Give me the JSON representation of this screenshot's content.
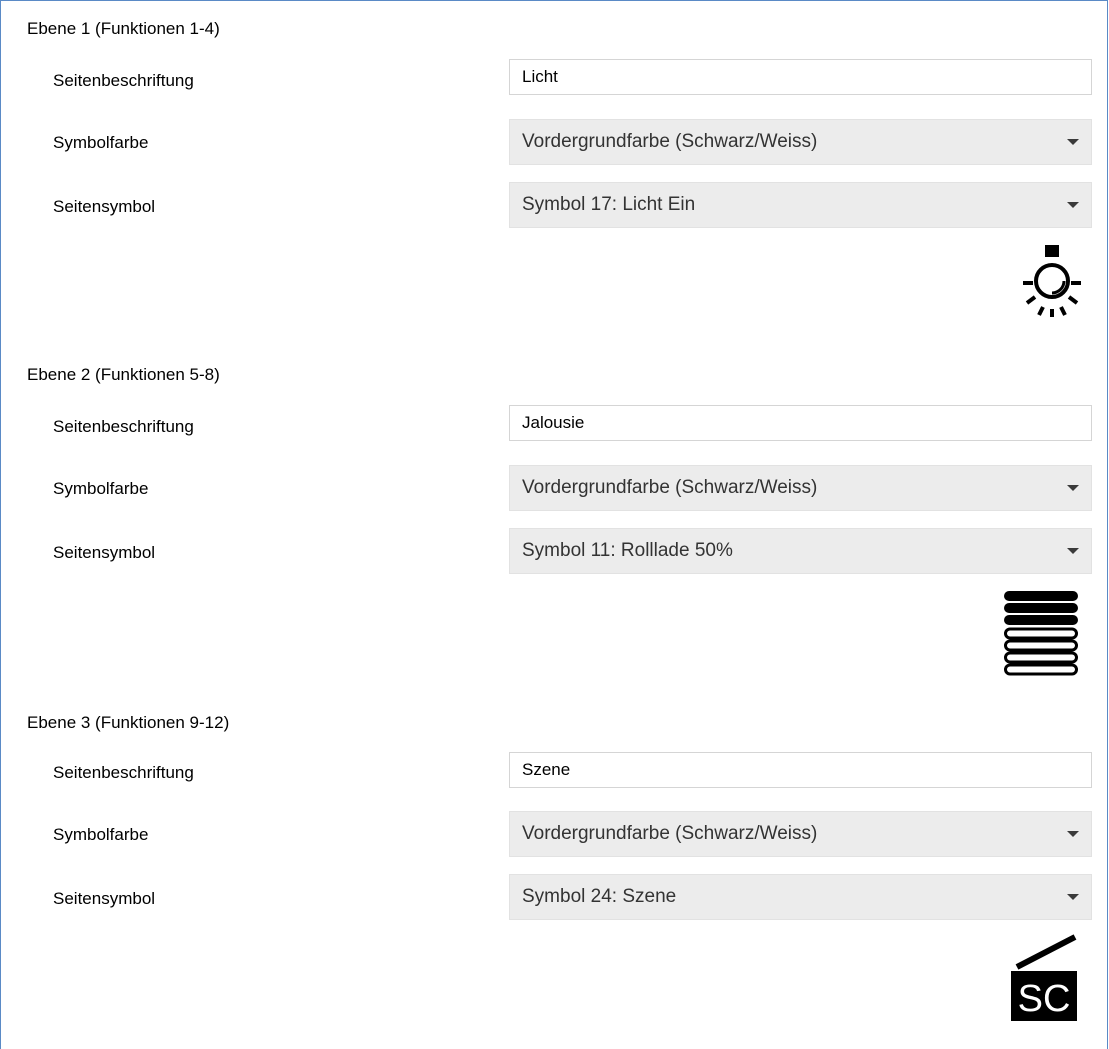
{
  "sections": [
    {
      "title": "Ebene 1 (Funktionen 1-4)",
      "caption_label": "Seitenbeschriftung",
      "caption_value": "Licht",
      "color_label": "Symbolfarbe",
      "color_value": "Vordergrundfarbe (Schwarz/Weiss)",
      "symbol_label": "Seitensymbol",
      "symbol_value": "Symbol 17: Licht Ein",
      "symbol_icon": "light-bulb-on-icon"
    },
    {
      "title": "Ebene 2 (Funktionen 5-8)",
      "caption_label": "Seitenbeschriftung",
      "caption_value": "Jalousie",
      "color_label": "Symbolfarbe",
      "color_value": "Vordergrundfarbe (Schwarz/Weiss)",
      "symbol_label": "Seitensymbol",
      "symbol_value": "Symbol 11: Rolllade 50%",
      "symbol_icon": "roller-shutter-50-icon"
    },
    {
      "title": "Ebene 3 (Funktionen 9-12)",
      "caption_label": "Seitenbeschriftung",
      "caption_value": "Szene",
      "color_label": "Symbolfarbe",
      "color_value": "Vordergrundfarbe (Schwarz/Weiss)",
      "symbol_label": "Seitensymbol",
      "symbol_value": "Symbol 24: Szene",
      "symbol_icon": "scene-clapper-icon",
      "symbol_icon_text": "SC"
    }
  ],
  "colors": {
    "frame_border": "#5a8ac6",
    "dropdown_bg": "#ececec",
    "input_border": "#d5d5d5"
  }
}
